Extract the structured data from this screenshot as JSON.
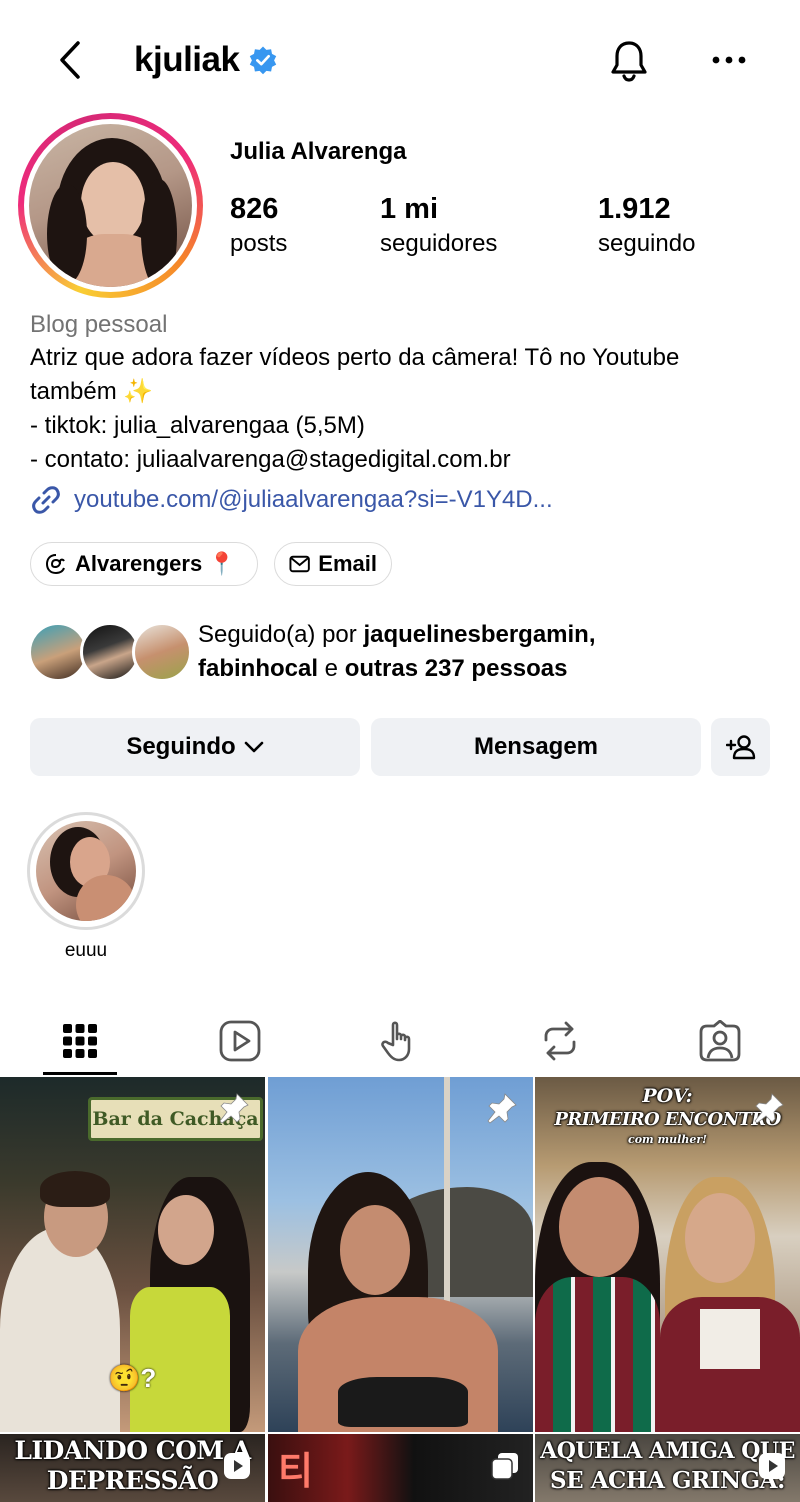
{
  "header": {
    "username": "kjuliak",
    "verified_color": "#3897f0"
  },
  "profile": {
    "full_name": "Julia Alvarenga",
    "stats": [
      {
        "value": "826",
        "label": "posts"
      },
      {
        "value": "1 mi",
        "label": "seguidores"
      },
      {
        "value": "1.912",
        "label": "seguindo"
      }
    ],
    "category": "Blog pessoal",
    "bio": [
      "Atriz que adora fazer vídeos perto da câmera! Tô no Youtube",
      "também ✨",
      "- tiktok: julia_alvarengaa (5,5M)",
      "- contato: juliaalvarenga@stagedigital.com.br"
    ],
    "link": "youtube.com/@juliaalvarengaa?si=-V1Y4D...",
    "link_color": "#3a57a8"
  },
  "chips": [
    {
      "label": "Alvarengers 📍",
      "icon": "threads-icon"
    },
    {
      "label": "Email",
      "icon": "mail-icon"
    }
  ],
  "followed_by": {
    "prefix": "Seguido(a) por ",
    "user1": "jaquelinesbergamin",
    "comma": ",",
    "user2": "fabinhocal",
    "conj": " e ",
    "others": "outras 237 pessoas"
  },
  "actions": {
    "following": "Seguindo",
    "message": "Mensagem"
  },
  "highlights": [
    {
      "label": "euuu"
    }
  ],
  "tabs": [
    "grid-icon",
    "reels-icon",
    "tap-icon",
    "reposts-icon",
    "tagged-icon"
  ],
  "posts": [
    {
      "sign": "Bar da Cachaça",
      "emoji": "🤨?"
    },
    {},
    {
      "line1": "POV:",
      "line2": "PRIMEIRO ENCONTRO",
      "line3": "com mulher!"
    }
  ],
  "posts_row2": [
    {
      "line1": "LIDANDO COM A",
      "line2": "DEPRESSÃO"
    },
    {
      "text": "티"
    },
    {
      "line1": "AQUELA AMIGA QUE",
      "line2": "SE ACHA GRINGA:"
    }
  ]
}
